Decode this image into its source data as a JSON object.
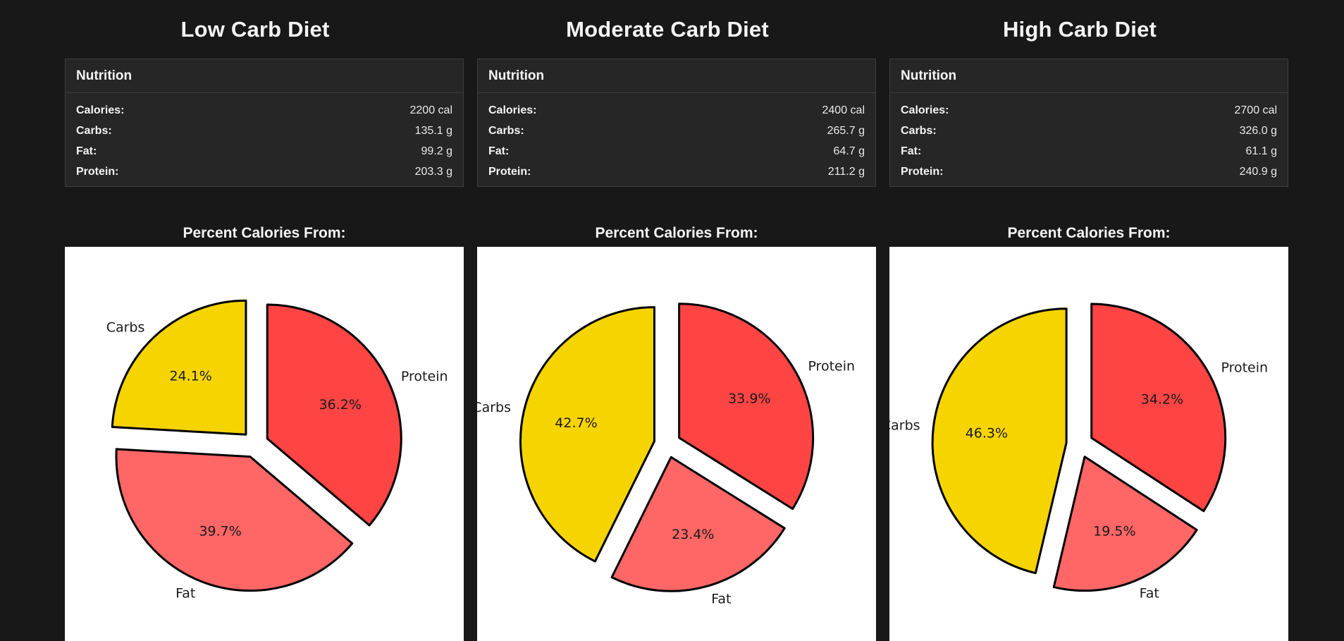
{
  "diets": [
    {
      "title": "Low Carb Diet",
      "nutrition_header": "Nutrition",
      "rows": [
        {
          "label": "Calories:",
          "value": "2200 cal"
        },
        {
          "label": "Carbs:",
          "value": "135.1 g"
        },
        {
          "label": "Fat:",
          "value": "99.2 g"
        },
        {
          "label": "Protein:",
          "value": "203.3 g"
        }
      ],
      "chart_title": "Percent Calories From:"
    },
    {
      "title": "Moderate Carb Diet",
      "nutrition_header": "Nutrition",
      "rows": [
        {
          "label": "Calories:",
          "value": "2400 cal"
        },
        {
          "label": "Carbs:",
          "value": "265.7 g"
        },
        {
          "label": "Fat:",
          "value": "64.7 g"
        },
        {
          "label": "Protein:",
          "value": "211.2 g"
        }
      ],
      "chart_title": "Percent Calories From:"
    },
    {
      "title": "High Carb Diet",
      "nutrition_header": "Nutrition",
      "rows": [
        {
          "label": "Calories:",
          "value": "2700 cal"
        },
        {
          "label": "Carbs:",
          "value": "326.0 g"
        },
        {
          "label": "Fat:",
          "value": "61.1 g"
        },
        {
          "label": "Protein:",
          "value": "240.9 g"
        }
      ],
      "chart_title": "Percent Calories From:"
    }
  ],
  "chart_data": [
    {
      "type": "pie",
      "title": "Percent Calories From:",
      "labels": [
        "Carbs",
        "Fat",
        "Protein"
      ],
      "values": [
        24.1,
        39.7,
        36.2
      ],
      "value_labels": [
        "24.1%",
        "39.7%",
        "36.2%"
      ],
      "colors": [
        "#f5d400",
        "#ff6666",
        "#ff4444"
      ],
      "exploded": true
    },
    {
      "type": "pie",
      "title": "Percent Calories From:",
      "labels": [
        "Carbs",
        "Fat",
        "Protein"
      ],
      "values": [
        42.7,
        23.4,
        33.9
      ],
      "value_labels": [
        "42.7%",
        "23.4%",
        "33.9%"
      ],
      "colors": [
        "#f5d400",
        "#ff6666",
        "#ff4444"
      ],
      "exploded": true
    },
    {
      "type": "pie",
      "title": "Percent Calories From:",
      "labels": [
        "Carbs",
        "Fat",
        "Protein"
      ],
      "values": [
        46.3,
        19.5,
        34.2
      ],
      "value_labels": [
        "46.3%",
        "19.5%",
        "34.2%"
      ],
      "colors": [
        "#f5d400",
        "#ff6666",
        "#ff4444"
      ],
      "exploded": true
    }
  ]
}
